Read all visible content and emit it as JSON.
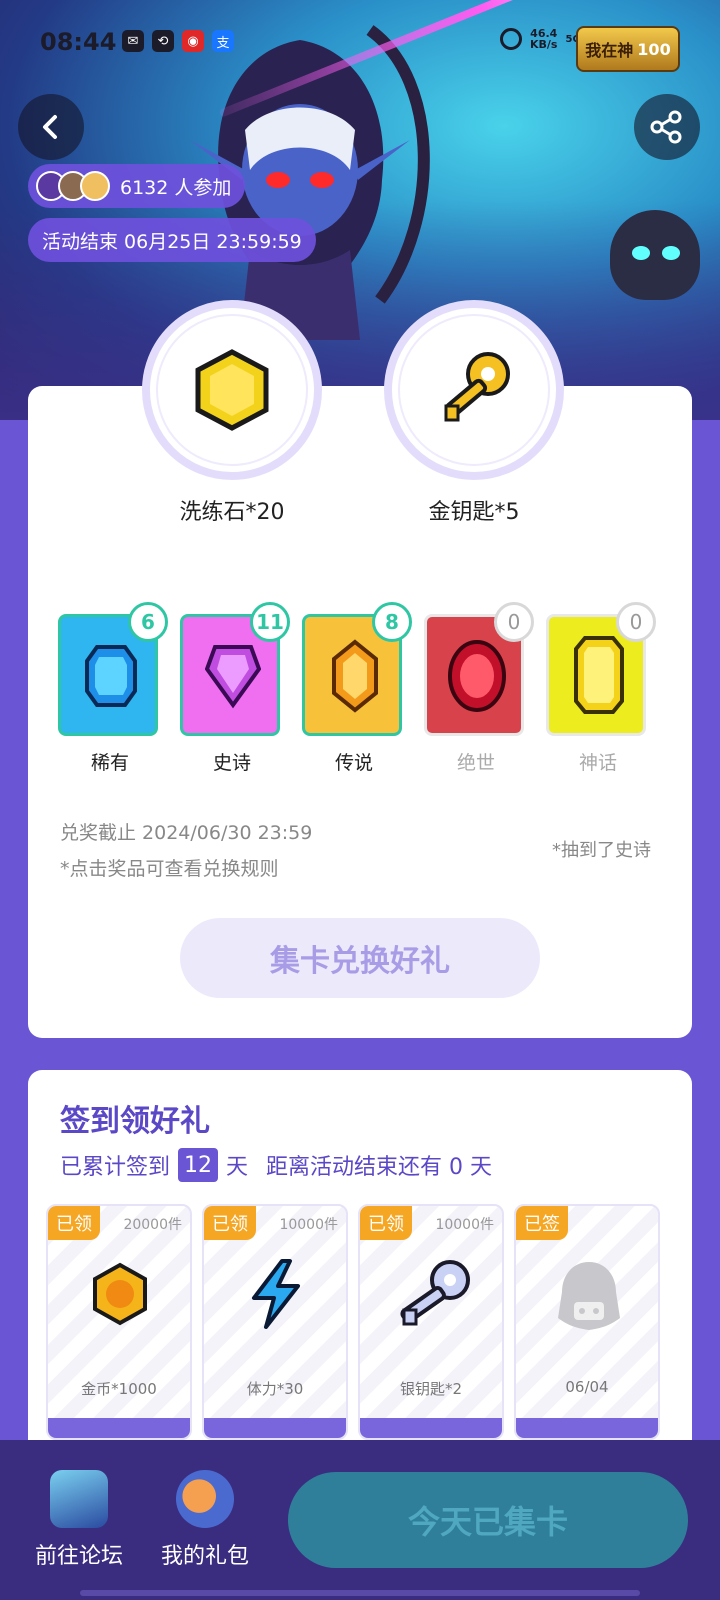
{
  "status_bar": {
    "time": "08:44",
    "net_speed_value": "46.4",
    "net_speed_unit": "KB/s",
    "network": "5G"
  },
  "hero": {
    "game_logo_text": "我在神",
    "game_logo_level": "100",
    "participants_count_text": "6132 人参加",
    "end_time_text": "活动结束 06月25日 23:59:59"
  },
  "rewards": [
    {
      "label": "洗练石*20",
      "icon": "whetstone-icon"
    },
    {
      "label": "金钥匙*5",
      "icon": "gold-key-icon"
    }
  ],
  "gems": [
    {
      "label": "稀有",
      "count": "6",
      "color": "#2fb6f0",
      "owned": true
    },
    {
      "label": "史诗",
      "count": "11",
      "color": "#f06ef0",
      "owned": true
    },
    {
      "label": "传说",
      "count": "8",
      "color": "#f7c23a",
      "owned": true
    },
    {
      "label": "绝世",
      "count": "0",
      "color": "#d8424a",
      "owned": false
    },
    {
      "label": "神话",
      "count": "0",
      "color": "#ecec1e",
      "owned": false
    }
  ],
  "redeem": {
    "deadline": "兑奖截止 2024/06/30 23:59",
    "note": "*点击奖品可查看兑换规则",
    "draw_note": "*抽到了史诗",
    "button": "集卡兑换好礼"
  },
  "signin": {
    "title": "签到领好礼",
    "prefix": "已累计签到",
    "days": "12",
    "unit": "天",
    "remaining_text": "距离活动结束还有 0 天",
    "tiles": [
      {
        "tag": "已领",
        "count": "20000件",
        "name": "金币*1000",
        "icon": "gold-coin-icon"
      },
      {
        "tag": "已领",
        "count": "10000件",
        "name": "体力*30",
        "icon": "lightning-icon"
      },
      {
        "tag": "已领",
        "count": "10000件",
        "name": "银钥匙*2",
        "icon": "silver-key-icon"
      },
      {
        "tag": "已签",
        "count": "",
        "name": "06/04",
        "icon": "hidden-reward-icon"
      }
    ]
  },
  "bottom": {
    "forum_label": "前往论坛",
    "gift_label": "我的礼包",
    "collect_button": "今天已集卡"
  },
  "colors": {
    "primary": "#6a55d4",
    "accent_green": "#2fc6a4",
    "tag_orange": "#f5a623",
    "bottom_bg": "#3a2d80"
  }
}
